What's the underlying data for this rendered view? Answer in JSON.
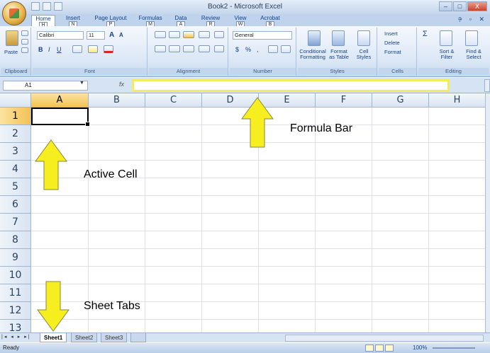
{
  "window": {
    "title": "Book2 - Microsoft Excel",
    "controls": [
      "–",
      "□",
      "X"
    ]
  },
  "ribbon_tabs": [
    {
      "label": "Home",
      "key": "H"
    },
    {
      "label": "Insert",
      "key": "N"
    },
    {
      "label": "Page Layout",
      "key": "P"
    },
    {
      "label": "Formulas",
      "key": "M"
    },
    {
      "label": "Data",
      "key": "A"
    },
    {
      "label": "Review",
      "key": "R"
    },
    {
      "label": "View",
      "key": "W"
    },
    {
      "label": "Acrobat",
      "key": "B"
    }
  ],
  "ribbon": {
    "clipboard": {
      "label": "Clipboard",
      "paste": "Paste"
    },
    "font": {
      "label": "Font",
      "name": "Calibri",
      "size": "11",
      "bold": "B",
      "italic": "I",
      "underline": "U",
      "grow": "A",
      "shrink": "A"
    },
    "alignment": {
      "label": "Alignment"
    },
    "number": {
      "label": "Number",
      "format": "General",
      "currency": "$",
      "percent": "%",
      "comma": ","
    },
    "styles": {
      "label": "Styles",
      "conditional": "Conditional Formatting",
      "format_table": "Format as Table",
      "cell_styles": "Cell Styles"
    },
    "cells": {
      "label": "Cells",
      "insert": "Insert",
      "delete": "Delete",
      "format": "Format"
    },
    "editing": {
      "label": "Editing",
      "sum": "Σ",
      "sort": "Sort & Filter",
      "find": "Find & Select"
    }
  },
  "formula_bar": {
    "name_box": "A1",
    "fx": "fx",
    "value": ""
  },
  "columns": [
    "A",
    "B",
    "C",
    "D",
    "E",
    "F",
    "G",
    "H"
  ],
  "rows": [
    "1",
    "2",
    "3",
    "4",
    "5",
    "6",
    "7",
    "8",
    "9",
    "10",
    "11",
    "12",
    "13"
  ],
  "active_cell": "A1",
  "sheets": [
    "Sheet1",
    "Sheet2",
    "Sheet3"
  ],
  "active_sheet": "Sheet1",
  "status": {
    "text": "Ready",
    "zoom": "100%"
  },
  "annotations": {
    "formula_bar": "Formula Bar",
    "active_cell": "Active Cell",
    "sheet_tabs": "Sheet Tabs"
  },
  "colors": {
    "highlight": "#f3ed5e",
    "arrow": "#f6ee1f",
    "selected_header": "#f4c255"
  }
}
